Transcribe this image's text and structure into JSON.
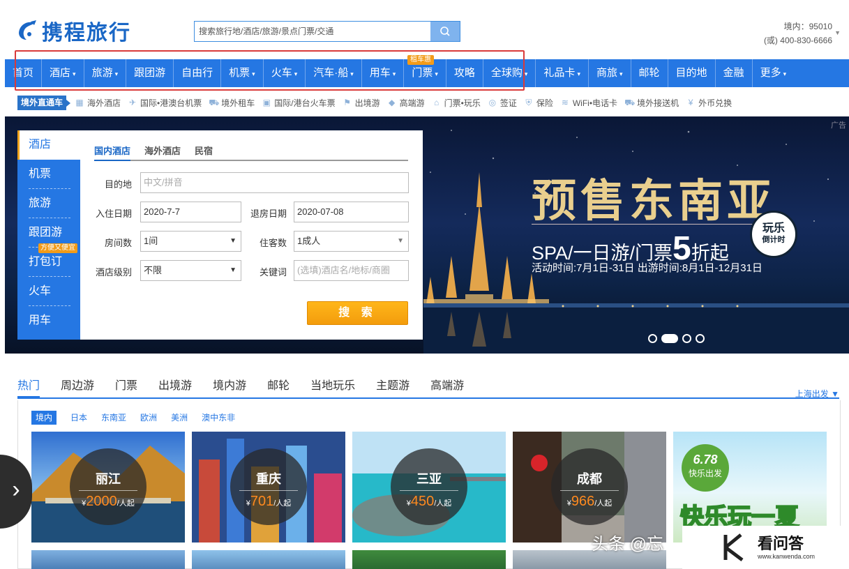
{
  "header": {
    "logo_text": "携程旅行",
    "search_placeholder": "搜索旅行地/酒店/旅游/景点门票/交通",
    "hotline_domestic": "境内：95010",
    "hotline_alt": "(或) 400-830-6666"
  },
  "nav": {
    "items": [
      {
        "label": "首页"
      },
      {
        "label": "酒店",
        "dropdown": true
      },
      {
        "label": "旅游",
        "dropdown": true
      },
      {
        "label": "跟团游"
      },
      {
        "label": "自由行"
      },
      {
        "label": "机票",
        "dropdown": true
      },
      {
        "label": "火车",
        "dropdown": true
      },
      {
        "label": "汽车·船",
        "dropdown": true
      },
      {
        "label": "用车",
        "dropdown": true
      },
      {
        "label": "门票",
        "dropdown": true
      },
      {
        "label": "攻略"
      },
      {
        "label": "全球购",
        "dropdown": true
      },
      {
        "label": "礼品卡",
        "dropdown": true
      },
      {
        "label": "商旅",
        "dropdown": true
      },
      {
        "label": "邮轮"
      },
      {
        "label": "目的地"
      },
      {
        "label": "金融"
      },
      {
        "label": "更多",
        "dropdown": true
      }
    ],
    "rent_badge": "租车惠",
    "caret": "▾",
    "highlight_color": "#d93a3a",
    "nav_color": "#2577e3"
  },
  "subnav": {
    "title": "境外直通车",
    "items": [
      "海外酒店",
      "国际•港澳台机票",
      "境外租车",
      "国际/港台火车票",
      "出境游",
      "高端游",
      "门票•玩乐",
      "签证",
      "保险",
      "WiFi•电话卡",
      "境外接送机",
      "外币兑换"
    ]
  },
  "booking": {
    "side": [
      "酒店",
      "机票",
      "旅游",
      "跟团游",
      "打包订",
      "火车",
      "用车"
    ],
    "side_badge": "方便又便宜",
    "tabs": [
      "国内酒店",
      "海外酒店",
      "民宿"
    ],
    "destination_label": "目的地",
    "destination_placeholder": "中文/拼音",
    "checkin_label": "入住日期",
    "checkin_value": "2020-7-7",
    "checkout_label": "退房日期",
    "checkout_value": "2020-07-08",
    "rooms_label": "房间数",
    "rooms_value": "1间",
    "guests_label": "住客数",
    "guests_value": "1成人",
    "level_label": "酒店级别",
    "level_value": "不限",
    "keyword_label": "关键词",
    "keyword_placeholder": "(选填)酒店名/地标/商圈",
    "search_button": "搜 索"
  },
  "banner": {
    "ad_tag": "广告",
    "title": "预售东南亚",
    "subtitle_pre": "SPA/一日游/门票",
    "subtitle_num": "5",
    "subtitle_post": "折起",
    "dates": "活动时间:7月1日-31日   出游时间:8月1日-12月31日",
    "stamp_line1": "玩乐",
    "stamp_line2": "倒计时",
    "slide_count": 4,
    "active_slide": 2
  },
  "categories": {
    "tabs": [
      "热门",
      "周边游",
      "门票",
      "出境游",
      "境内游",
      "邮轮",
      "当地玩乐",
      "主题游",
      "高端游"
    ],
    "city_select": "上海出发 ▼",
    "regions": [
      "境内",
      "日本",
      "东南亚",
      "欧洲",
      "美洲",
      "澳中东非"
    ]
  },
  "cards": [
    {
      "name": "丽江",
      "currency": "¥",
      "price": "2000",
      "unit": "/人起"
    },
    {
      "name": "重庆",
      "currency": "¥",
      "price": "701",
      "unit": "/人起"
    },
    {
      "name": "三亚",
      "currency": "¥",
      "price": "450",
      "unit": "/人起"
    },
    {
      "name": "成都",
      "currency": "¥",
      "price": "966",
      "unit": "/人起"
    }
  ],
  "promo_card": {
    "badge_top": "6.78",
    "badge_bottom": "快乐出发",
    "title": "快乐玩一夏"
  },
  "overlays": {
    "watermark": "头条 @忘",
    "kw_title": "看问答",
    "kw_url": "www.kanwenda.com"
  }
}
